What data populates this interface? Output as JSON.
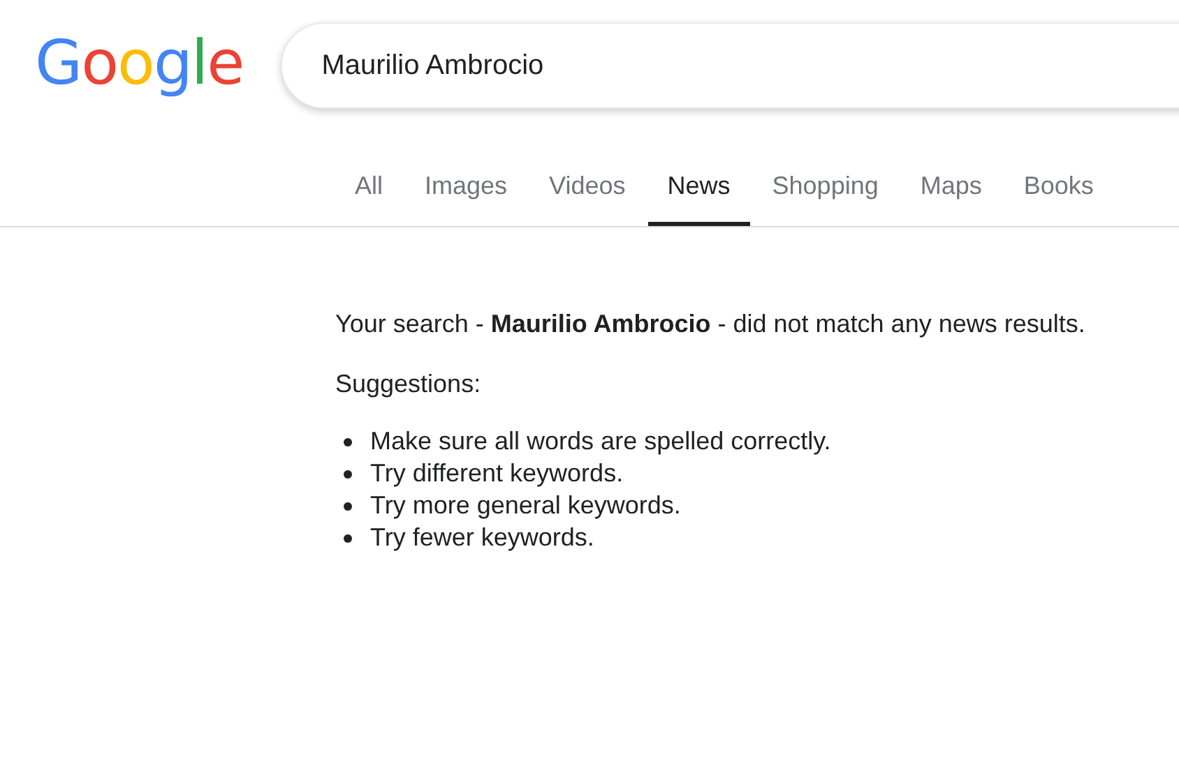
{
  "logo": "Google",
  "search": {
    "value": "Maurilio Ambrocio"
  },
  "tabs": [
    {
      "label": "All",
      "selected": false
    },
    {
      "label": "Images",
      "selected": false
    },
    {
      "label": "Videos",
      "selected": false
    },
    {
      "label": "News",
      "selected": true
    },
    {
      "label": "Shopping",
      "selected": false
    },
    {
      "label": "Maps",
      "selected": false
    },
    {
      "label": "Books",
      "selected": false
    }
  ],
  "message": "Your search - **Maurilio Ambrocio** - did not match any news results.",
  "suggestions_heading": "Suggestions:",
  "suggestions": [
    "Make sure all words are spelled correctly.",
    "Try different keywords.",
    "Try more general keywords.",
    "Try fewer keywords."
  ]
}
